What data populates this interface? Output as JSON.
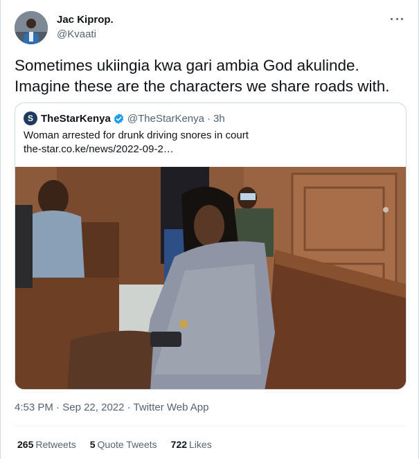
{
  "author": {
    "name": "Jac Kiprop.",
    "handle": "@Kvaati"
  },
  "tweet": {
    "lines": [
      "Sometimes ukiingia kwa gari ambia God akulinde.",
      "Imagine these are the characters we share roads with."
    ]
  },
  "quoted_tweet": {
    "name": "TheStarKenya",
    "handle": "@TheStarKenya",
    "separator": "·",
    "time": "3h",
    "headline": "Woman arrested for drunk driving snores in court",
    "link": "the-star.co.ke/news/2022-09-2…",
    "logo_letter": "S",
    "media_description_icon": "photo-courtroom"
  },
  "meta": {
    "time": "4:53 PM",
    "separator": "·",
    "date": "Sep 22, 2022",
    "source": "Twitter Web App"
  },
  "stats": {
    "retweets_count": "265",
    "retweets_label": "Retweets",
    "quotes_count": "5",
    "quotes_label": "Quote Tweets",
    "likes_count": "722",
    "likes_label": "Likes"
  },
  "colors": {
    "text_primary": "#0f1419",
    "text_secondary": "#536471",
    "border": "#cfd9de",
    "verified_blue": "#1d9bf0"
  }
}
